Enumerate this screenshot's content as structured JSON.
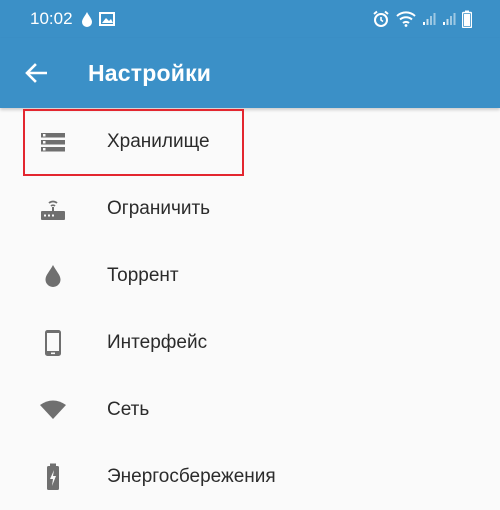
{
  "status_bar": {
    "time": "10:02",
    "left_icons": [
      "drop-icon",
      "image-icon"
    ],
    "right_icons": [
      "alarm-icon",
      "wifi-icon",
      "signal-icon",
      "signal-icon",
      "battery-icon"
    ]
  },
  "app_bar": {
    "title": "Настройки",
    "back_icon": "arrow-left-icon",
    "background_color": "#3b90c7"
  },
  "settings": {
    "items": [
      {
        "label": "Хранилище",
        "icon": "storage-icon",
        "highlighted": true
      },
      {
        "label": "Ограничить",
        "icon": "router-icon"
      },
      {
        "label": "Торрент",
        "icon": "drop-icon"
      },
      {
        "label": "Интерфейс",
        "icon": "phone-icon"
      },
      {
        "label": "Сеть",
        "icon": "wifi-icon"
      },
      {
        "label": "Энергосбережения",
        "icon": "battery-charging-icon"
      }
    ]
  },
  "highlight_color": "#e3262f"
}
